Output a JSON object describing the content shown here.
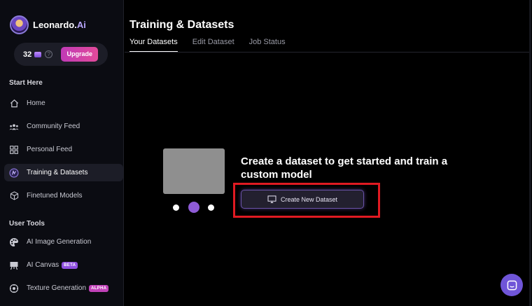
{
  "brand": {
    "name": "Leonardo.",
    "name_suffix": "Ai"
  },
  "credits": {
    "count": "32",
    "upgrade_label": "Upgrade"
  },
  "sidebar": {
    "sections": [
      {
        "title": "Start Here",
        "items": [
          {
            "label": "Home",
            "icon": "home-icon",
            "active": false
          },
          {
            "label": "Community Feed",
            "icon": "community-icon",
            "active": false
          },
          {
            "label": "Personal Feed",
            "icon": "grid-icon",
            "active": false
          },
          {
            "label": "Training & Datasets",
            "icon": "training-icon",
            "active": true
          },
          {
            "label": "Finetuned Models",
            "icon": "cube-icon",
            "active": false
          }
        ]
      },
      {
        "title": "User Tools",
        "items": [
          {
            "label": "AI Image Generation",
            "icon": "palette-icon",
            "active": false
          },
          {
            "label": "AI Canvas",
            "icon": "easel-icon",
            "active": false,
            "badge": "BETA"
          },
          {
            "label": "Texture Generation",
            "icon": "texture-icon",
            "active": false,
            "badge": "ALPHA"
          }
        ]
      }
    ]
  },
  "main": {
    "title": "Training & Datasets",
    "tabs": [
      {
        "label": "Your Datasets",
        "active": true
      },
      {
        "label": "Edit Dataset",
        "active": false
      },
      {
        "label": "Job Status",
        "active": false
      }
    ],
    "empty_state": {
      "message": "Create a dataset to get started and train a custom model",
      "button_label": "Create New Dataset",
      "carousel_active_index": 1
    }
  },
  "colors": {
    "accent_purple": "#8e5bd6",
    "upgrade_gradient_start": "#c03ab6",
    "upgrade_gradient_end": "#e24a9a",
    "highlight_red": "#e01a22",
    "chat_bubble": "#6f55d8"
  }
}
